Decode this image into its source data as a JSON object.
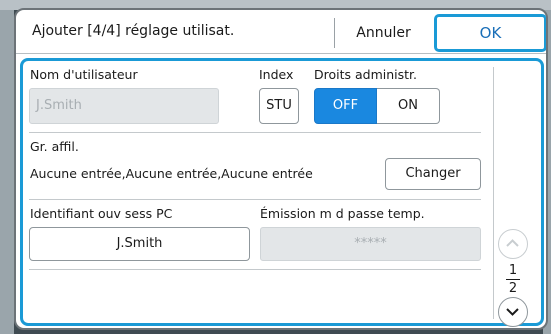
{
  "dialog": {
    "title": "Ajouter [4/4] réglage utilisat.",
    "cancel_label": "Annuler",
    "ok_label": "OK"
  },
  "fields": {
    "username_label": "Nom d'utilisateur",
    "username_value": "J.Smith",
    "index_label": "Index",
    "index_button": "STU",
    "admin_label": "Droits administr.",
    "admin_off": "OFF",
    "admin_on": "ON",
    "group_label": "Gr. affil.",
    "group_value": "Aucune entrée,Aucune entrée,Aucune entrée",
    "change_button": "Changer",
    "pc_login_label": "Identifiant ouv sess PC",
    "pc_login_value": "J.Smith",
    "temp_password_label": "Émission m d passe temp.",
    "temp_password_value": "*****"
  },
  "pager": {
    "current": "1",
    "total": "2"
  },
  "colors": {
    "accent": "#1a9ad6",
    "toggle_active": "#1a88e0"
  }
}
